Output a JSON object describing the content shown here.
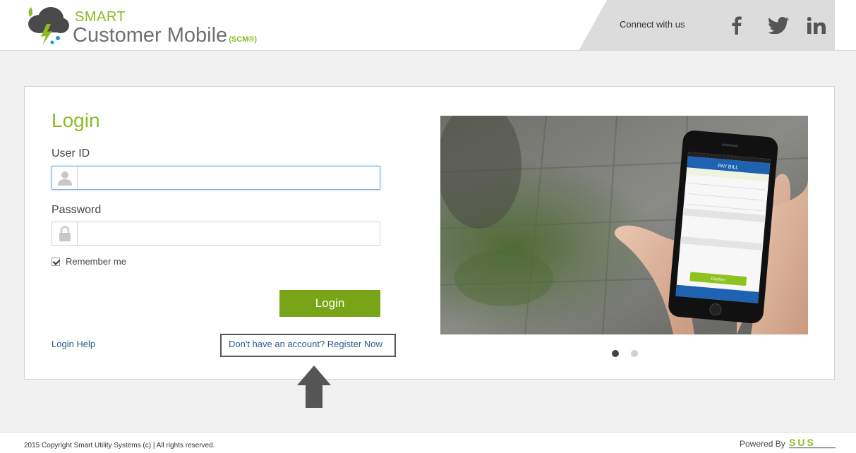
{
  "header": {
    "brand_small": "SMART",
    "brand_title": "Customer Mobile",
    "brand_suffix": "(SCM®)",
    "connect_label": "Connect with us",
    "social": [
      "facebook-icon",
      "twitter-icon",
      "linkedin-icon"
    ]
  },
  "login": {
    "title": "Login",
    "user_id_label": "User ID",
    "user_id_value": "",
    "password_label": "Password",
    "password_value": "",
    "remember_label": "Remember me",
    "remember_checked": true,
    "submit_label": "Login",
    "help_link": "Login Help",
    "register_link": "Don't have an account? Register Now"
  },
  "carousel": {
    "slides": 2,
    "active_slide": 1,
    "phone_screen": {
      "back": "Back",
      "title": "PAY BILL",
      "cancel": "Cancel",
      "billing_period": "BILLING PERIOD: 03/05/2014 to 30/04/2014",
      "account": "ACCT# 10000002",
      "due_date_label": "Due Date",
      "due_date_value": "4/15/14",
      "balance_label": "Total Balance Due",
      "balance_value": "$105.00",
      "pay_label": "Pay Amount",
      "pay_placeholder": "Enter Amount",
      "property_header": "PROPERTY",
      "address_line1": "1390 Punchbowl St",
      "address_line2": "Chino Hills, Ca 91709",
      "payment_header": "PAYMENT TYPE",
      "card_name": "American Express",
      "card_number": "**********0004",
      "card_exp": "11/14",
      "confirm": "Confirm",
      "carrier": "T-Mobile",
      "time": "3:10 PM"
    }
  },
  "footer": {
    "copyright": "2015 Copyright Smart Utility Systems (c) | All rights reserved.",
    "powered_by": "Powered By",
    "powered_logo": "SUS"
  },
  "colors": {
    "brand_green": "#8dbb25",
    "button_green": "#78a518",
    "link_blue": "#2a5a8f",
    "background": "#f1f1f1"
  }
}
